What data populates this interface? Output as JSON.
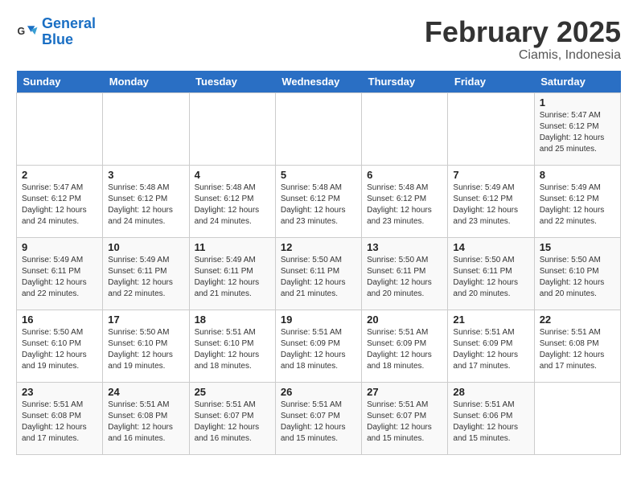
{
  "header": {
    "logo_line1": "General",
    "logo_line2": "Blue",
    "title": "February 2025",
    "subtitle": "Ciamis, Indonesia"
  },
  "days_of_week": [
    "Sunday",
    "Monday",
    "Tuesday",
    "Wednesday",
    "Thursday",
    "Friday",
    "Saturday"
  ],
  "weeks": [
    [
      {
        "num": "",
        "info": ""
      },
      {
        "num": "",
        "info": ""
      },
      {
        "num": "",
        "info": ""
      },
      {
        "num": "",
        "info": ""
      },
      {
        "num": "",
        "info": ""
      },
      {
        "num": "",
        "info": ""
      },
      {
        "num": "1",
        "info": "Sunrise: 5:47 AM\nSunset: 6:12 PM\nDaylight: 12 hours\nand 25 minutes."
      }
    ],
    [
      {
        "num": "2",
        "info": "Sunrise: 5:47 AM\nSunset: 6:12 PM\nDaylight: 12 hours\nand 24 minutes."
      },
      {
        "num": "3",
        "info": "Sunrise: 5:48 AM\nSunset: 6:12 PM\nDaylight: 12 hours\nand 24 minutes."
      },
      {
        "num": "4",
        "info": "Sunrise: 5:48 AM\nSunset: 6:12 PM\nDaylight: 12 hours\nand 24 minutes."
      },
      {
        "num": "5",
        "info": "Sunrise: 5:48 AM\nSunset: 6:12 PM\nDaylight: 12 hours\nand 23 minutes."
      },
      {
        "num": "6",
        "info": "Sunrise: 5:48 AM\nSunset: 6:12 PM\nDaylight: 12 hours\nand 23 minutes."
      },
      {
        "num": "7",
        "info": "Sunrise: 5:49 AM\nSunset: 6:12 PM\nDaylight: 12 hours\nand 23 minutes."
      },
      {
        "num": "8",
        "info": "Sunrise: 5:49 AM\nSunset: 6:12 PM\nDaylight: 12 hours\nand 22 minutes."
      }
    ],
    [
      {
        "num": "9",
        "info": "Sunrise: 5:49 AM\nSunset: 6:11 PM\nDaylight: 12 hours\nand 22 minutes."
      },
      {
        "num": "10",
        "info": "Sunrise: 5:49 AM\nSunset: 6:11 PM\nDaylight: 12 hours\nand 22 minutes."
      },
      {
        "num": "11",
        "info": "Sunrise: 5:49 AM\nSunset: 6:11 PM\nDaylight: 12 hours\nand 21 minutes."
      },
      {
        "num": "12",
        "info": "Sunrise: 5:50 AM\nSunset: 6:11 PM\nDaylight: 12 hours\nand 21 minutes."
      },
      {
        "num": "13",
        "info": "Sunrise: 5:50 AM\nSunset: 6:11 PM\nDaylight: 12 hours\nand 20 minutes."
      },
      {
        "num": "14",
        "info": "Sunrise: 5:50 AM\nSunset: 6:11 PM\nDaylight: 12 hours\nand 20 minutes."
      },
      {
        "num": "15",
        "info": "Sunrise: 5:50 AM\nSunset: 6:10 PM\nDaylight: 12 hours\nand 20 minutes."
      }
    ],
    [
      {
        "num": "16",
        "info": "Sunrise: 5:50 AM\nSunset: 6:10 PM\nDaylight: 12 hours\nand 19 minutes."
      },
      {
        "num": "17",
        "info": "Sunrise: 5:50 AM\nSunset: 6:10 PM\nDaylight: 12 hours\nand 19 minutes."
      },
      {
        "num": "18",
        "info": "Sunrise: 5:51 AM\nSunset: 6:10 PM\nDaylight: 12 hours\nand 18 minutes."
      },
      {
        "num": "19",
        "info": "Sunrise: 5:51 AM\nSunset: 6:09 PM\nDaylight: 12 hours\nand 18 minutes."
      },
      {
        "num": "20",
        "info": "Sunrise: 5:51 AM\nSunset: 6:09 PM\nDaylight: 12 hours\nand 18 minutes."
      },
      {
        "num": "21",
        "info": "Sunrise: 5:51 AM\nSunset: 6:09 PM\nDaylight: 12 hours\nand 17 minutes."
      },
      {
        "num": "22",
        "info": "Sunrise: 5:51 AM\nSunset: 6:08 PM\nDaylight: 12 hours\nand 17 minutes."
      }
    ],
    [
      {
        "num": "23",
        "info": "Sunrise: 5:51 AM\nSunset: 6:08 PM\nDaylight: 12 hours\nand 17 minutes."
      },
      {
        "num": "24",
        "info": "Sunrise: 5:51 AM\nSunset: 6:08 PM\nDaylight: 12 hours\nand 16 minutes."
      },
      {
        "num": "25",
        "info": "Sunrise: 5:51 AM\nSunset: 6:07 PM\nDaylight: 12 hours\nand 16 minutes."
      },
      {
        "num": "26",
        "info": "Sunrise: 5:51 AM\nSunset: 6:07 PM\nDaylight: 12 hours\nand 15 minutes."
      },
      {
        "num": "27",
        "info": "Sunrise: 5:51 AM\nSunset: 6:07 PM\nDaylight: 12 hours\nand 15 minutes."
      },
      {
        "num": "28",
        "info": "Sunrise: 5:51 AM\nSunset: 6:06 PM\nDaylight: 12 hours\nand 15 minutes."
      },
      {
        "num": "",
        "info": ""
      }
    ]
  ]
}
